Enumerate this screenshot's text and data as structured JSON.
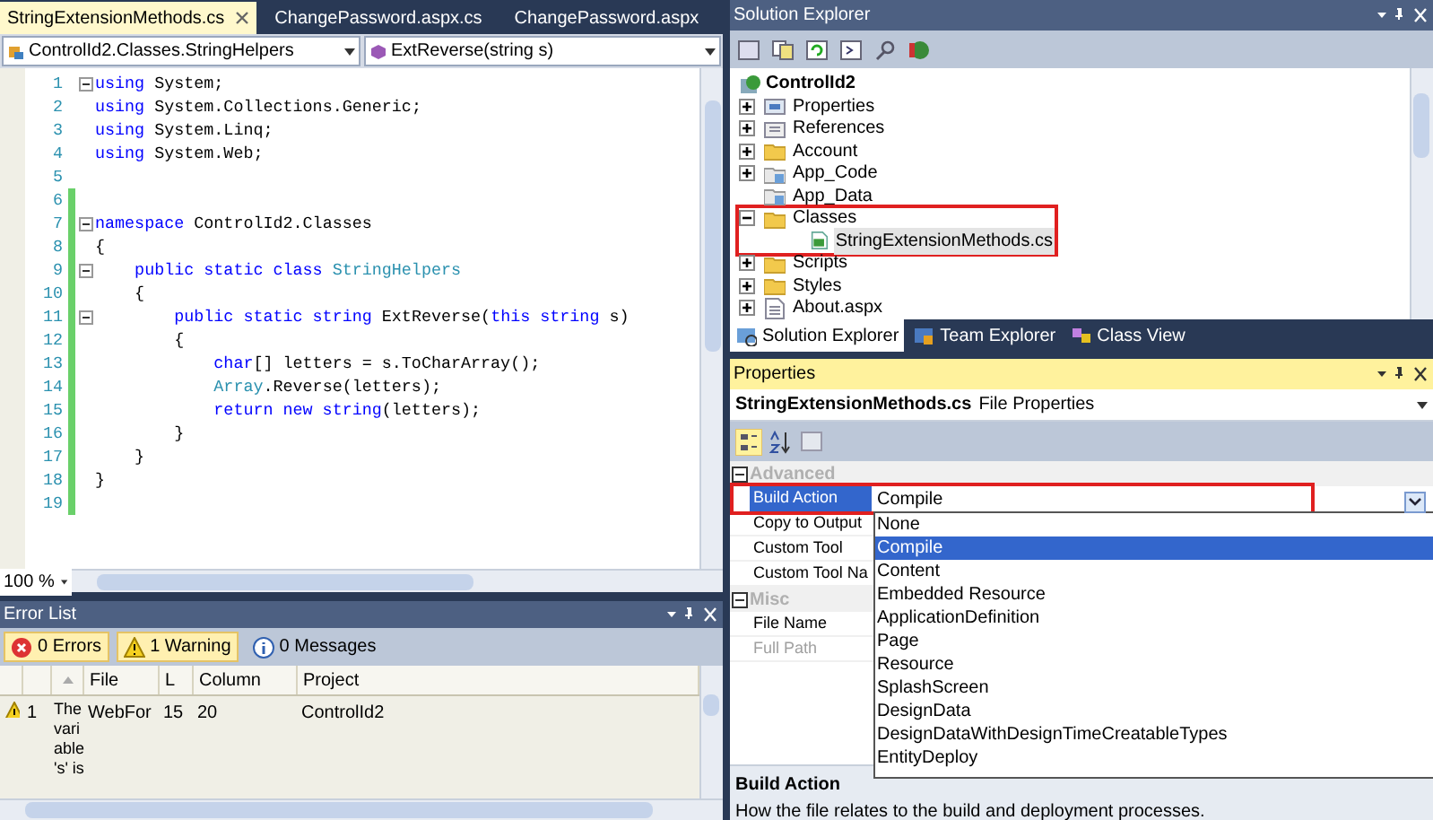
{
  "editor_tabs": [
    {
      "label": "StringExtensionMethods.cs",
      "selected": true
    },
    {
      "label": "ChangePassword.aspx.cs",
      "selected": false
    },
    {
      "label": "ChangePassword.aspx",
      "selected": false
    }
  ],
  "navigation_bar": {
    "type_dropdown": "ControlId2.Classes.StringHelpers",
    "member_dropdown": "ExtReverse(string s)"
  },
  "code_lines": [
    {
      "number": "1",
      "fold": true,
      "changed": false,
      "tokens": [
        {
          "kind": "keyword",
          "text": "using"
        },
        {
          "kind": "plain",
          "text": " System;"
        }
      ]
    },
    {
      "number": "2",
      "fold": false,
      "changed": false,
      "tokens": [
        {
          "kind": "keyword",
          "text": "using"
        },
        {
          "kind": "plain",
          "text": " System.Collections.Generic;"
        }
      ]
    },
    {
      "number": "3",
      "fold": false,
      "changed": false,
      "tokens": [
        {
          "kind": "keyword",
          "text": "using"
        },
        {
          "kind": "plain",
          "text": " System.Linq;"
        }
      ]
    },
    {
      "number": "4",
      "fold": false,
      "changed": false,
      "tokens": [
        {
          "kind": "keyword",
          "text": "using"
        },
        {
          "kind": "plain",
          "text": " System.Web;"
        }
      ]
    },
    {
      "number": "5",
      "fold": false,
      "changed": false
    },
    {
      "number": "6",
      "fold": false,
      "changed": true
    },
    {
      "number": "7",
      "fold": true,
      "changed": true,
      "tokens": [
        {
          "kind": "keyword",
          "text": "namespace"
        },
        {
          "kind": "plain",
          "text": " ControlId2.Classes"
        }
      ]
    },
    {
      "number": "8",
      "fold": false,
      "changed": true,
      "tokens": [
        {
          "kind": "plain",
          "text": "{"
        }
      ]
    },
    {
      "number": "9",
      "fold": true,
      "changed": true,
      "tokens": [
        {
          "kind": "keyword",
          "text": "    public static class"
        },
        {
          "kind": "type",
          "text": " StringHelpers"
        }
      ]
    },
    {
      "number": "10",
      "fold": false,
      "changed": true,
      "tokens": [
        {
          "kind": "plain",
          "text": "    {"
        }
      ]
    },
    {
      "number": "11",
      "fold": true,
      "changed": true,
      "tokens": [
        {
          "kind": "keyword",
          "text": "        public static string"
        },
        {
          "kind": "plain",
          "text": " ExtReverse("
        },
        {
          "kind": "keyword",
          "text": "this string"
        },
        {
          "kind": "plain",
          "text": " s)"
        }
      ]
    },
    {
      "number": "12",
      "fold": false,
      "changed": true,
      "tokens": [
        {
          "kind": "plain",
          "text": "        {"
        }
      ]
    },
    {
      "number": "13",
      "fold": false,
      "changed": true,
      "tokens": [
        {
          "kind": "keyword",
          "text": "            char"
        },
        {
          "kind": "plain",
          "text": "[] letters = s.ToCharArray();"
        }
      ]
    },
    {
      "number": "14",
      "fold": false,
      "changed": true,
      "tokens": [
        {
          "kind": "type",
          "text": "            Array"
        },
        {
          "kind": "plain",
          "text": ".Reverse(letters);"
        }
      ]
    },
    {
      "number": "15",
      "fold": false,
      "changed": true,
      "tokens": [
        {
          "kind": "keyword",
          "text": "            return new string"
        },
        {
          "kind": "plain",
          "text": "(letters);"
        }
      ]
    },
    {
      "number": "16",
      "fold": false,
      "changed": true,
      "tokens": [
        {
          "kind": "plain",
          "text": "        }"
        }
      ]
    },
    {
      "number": "17",
      "fold": false,
      "changed": true,
      "tokens": [
        {
          "kind": "plain",
          "text": "    }"
        }
      ]
    },
    {
      "number": "18",
      "fold": false,
      "changed": true,
      "tokens": [
        {
          "kind": "plain",
          "text": "}"
        }
      ]
    },
    {
      "number": "19",
      "fold": false,
      "changed": true
    }
  ],
  "zoom": "100 %",
  "error_list": {
    "title": "Error List",
    "filters": [
      {
        "kind": "error",
        "label": "0 Errors",
        "selected": true
      },
      {
        "kind": "warning",
        "label": "1 Warning",
        "selected": true
      },
      {
        "kind": "message",
        "label": "0 Messages",
        "selected": false
      }
    ],
    "columns": [
      "File",
      "L",
      "Column",
      "Project"
    ],
    "rows": [
      {
        "kind": "warning",
        "number": "1",
        "description": "The variable 's' is",
        "file": "WebFor",
        "line": "15",
        "column": "20",
        "project": "ControlId2"
      }
    ]
  },
  "solution_explorer": {
    "title": "Solution Explorer",
    "root": {
      "label": "ControlId2",
      "children": [
        {
          "label": "Properties",
          "kind": "properties",
          "expandable": true,
          "expanded": false,
          "selected": false,
          "annotated": false
        },
        {
          "label": "References",
          "kind": "references",
          "expandable": true,
          "expanded": false,
          "selected": false,
          "annotated": false
        },
        {
          "label": "Account",
          "kind": "folder",
          "expandable": true,
          "expanded": false,
          "selected": false,
          "annotated": false
        },
        {
          "label": "App_Code",
          "kind": "special_folder",
          "expandable": true,
          "expanded": false,
          "selected": false,
          "annotated": false
        },
        {
          "label": "App_Data",
          "kind": "special_folder",
          "expandable": false,
          "selected": false,
          "annotated": false
        },
        {
          "label": "Classes",
          "kind": "folder",
          "expandable": true,
          "expanded": true,
          "selected": false,
          "annotated": true,
          "children": [
            {
              "label": "StringExtensionMethods.cs",
              "kind": "cs_file",
              "expandable": false,
              "selected": true,
              "annotated": false
            }
          ]
        },
        {
          "label": "Scripts",
          "kind": "folder",
          "expandable": true,
          "expanded": false,
          "selected": false,
          "annotated": false
        },
        {
          "label": "Styles",
          "kind": "folder",
          "expandable": true,
          "expanded": false,
          "selected": false,
          "annotated": false
        },
        {
          "label": "About.aspx",
          "kind": "page",
          "expandable": true,
          "expanded": false,
          "selected": false,
          "annotated": false
        }
      ]
    },
    "tabs": [
      {
        "label": "Solution Explorer",
        "selected": true
      },
      {
        "label": "Team Explorer",
        "selected": false
      },
      {
        "label": "Class View",
        "selected": false
      }
    ]
  },
  "properties": {
    "title": "Properties",
    "object_name": "StringExtensionMethods.cs",
    "object_type": "File Properties",
    "categories": [
      {
        "label": "Advanced",
        "expanded": true,
        "items": [
          {
            "name": "Build Action",
            "value": "Compile",
            "selected": true,
            "disabled": false,
            "annotated": true
          },
          {
            "name": "Copy to Output",
            "selected": false,
            "disabled": false,
            "annotated": false
          },
          {
            "name": "Custom Tool",
            "selected": false,
            "disabled": false,
            "annotated": false
          },
          {
            "name": "Custom Tool Na",
            "selected": false,
            "disabled": false,
            "annotated": false
          }
        ]
      },
      {
        "label": "Misc",
        "expanded": true,
        "items": [
          {
            "name": "File Name",
            "selected": false,
            "disabled": false,
            "annotated": false
          },
          {
            "name": "Full Path",
            "selected": false,
            "disabled": true,
            "annotated": false
          }
        ]
      }
    ],
    "dropdown_options": [
      {
        "label": "None",
        "selected": false
      },
      {
        "label": "Compile",
        "selected": true
      },
      {
        "label": "Content",
        "selected": false
      },
      {
        "label": "Embedded Resource",
        "selected": false
      },
      {
        "label": "ApplicationDefinition",
        "selected": false
      },
      {
        "label": "Page",
        "selected": false
      },
      {
        "label": "Resource",
        "selected": false
      },
      {
        "label": "SplashScreen",
        "selected": false
      },
      {
        "label": "DesignData",
        "selected": false
      },
      {
        "label": "DesignDataWithDesignTimeCreatableTypes",
        "selected": false
      },
      {
        "label": "EntityDeploy",
        "selected": false
      }
    ],
    "description": {
      "title": "Build Action",
      "text": "How the file relates to the build and deployment processes."
    }
  }
}
